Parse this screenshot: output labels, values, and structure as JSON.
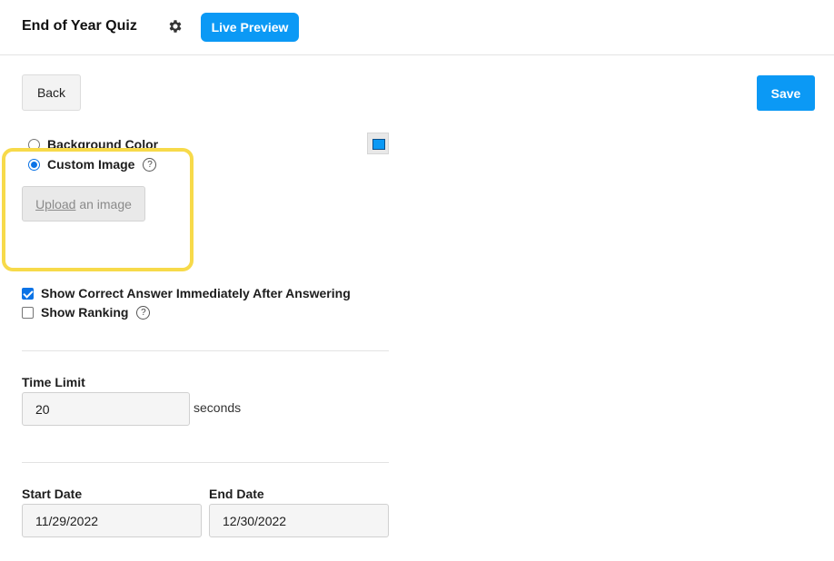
{
  "header": {
    "title": "End of Year Quiz",
    "settings_icon": "gear-icon",
    "live_preview_label": "Live Preview"
  },
  "toolbar": {
    "back_label": "Back",
    "save_label": "Save"
  },
  "background": {
    "color_option_label": "Background Color",
    "custom_image_label": "Custom Image",
    "selected": "Custom Image",
    "swatch_color": "#0b99f5",
    "help_glyph": "?",
    "upload_link": "Upload",
    "upload_rest": " an image"
  },
  "options": {
    "show_correct_label": "Show Correct Answer Immediately After Answering",
    "show_correct_checked": true,
    "show_ranking_label": "Show Ranking",
    "show_ranking_checked": false
  },
  "time_limit": {
    "label": "Time Limit",
    "value": "20",
    "unit": "seconds"
  },
  "dates": {
    "start_label": "Start Date",
    "start_value": "11/29/2022",
    "end_label": "End Date",
    "end_value": "12/30/2022"
  },
  "colors": {
    "accent": "#0b99f5",
    "highlight": "#f7da4a"
  }
}
